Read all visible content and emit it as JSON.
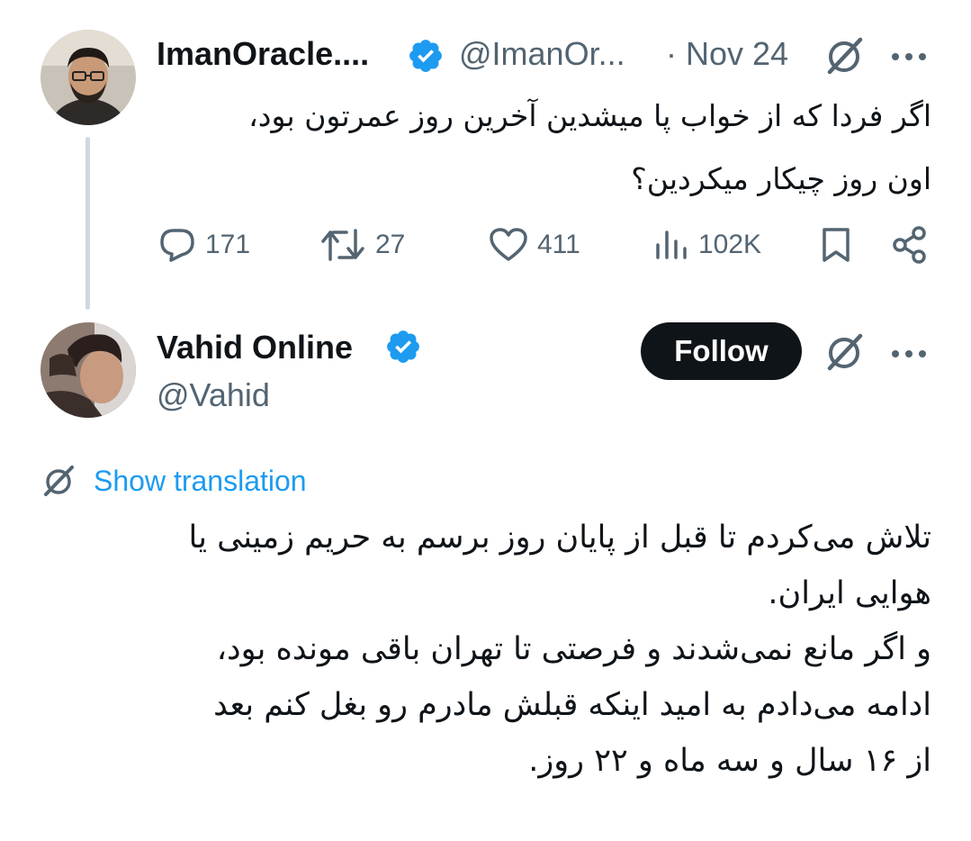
{
  "tweet1": {
    "author_name": "ImanOracle....",
    "handle": "@ImanOr...",
    "date": "· Nov 24",
    "text": "اگر فردا که از خواب پا میشدین آخرین روز عمرتون بود،\nاون روز چیکار میکردین؟",
    "actions": {
      "replies": "171",
      "retweets": "27",
      "likes": "411",
      "views": "102K"
    }
  },
  "tweet2": {
    "author_name": "Vahid Online",
    "handle": "@Vahid",
    "follow_label": "Follow",
    "translate_label": "Show translation",
    "text": "تلاش می‌کردم تا قبل از پایان روز برسم به حریم زمینی یا\nهوایی ایران.\nو اگر مانع نمی‌شدند و فرصتی تا تهران باقی مونده بود،\nادامه می‌دادم به امید اینکه قبلش مادرم رو بغل کنم بعد\nاز ۱۶ سال و سه ماه و ۲۲ روز."
  },
  "colors": {
    "accent": "#1d9bf0",
    "text": "#0f1419",
    "muted": "#536471",
    "line": "#cfd9de"
  }
}
